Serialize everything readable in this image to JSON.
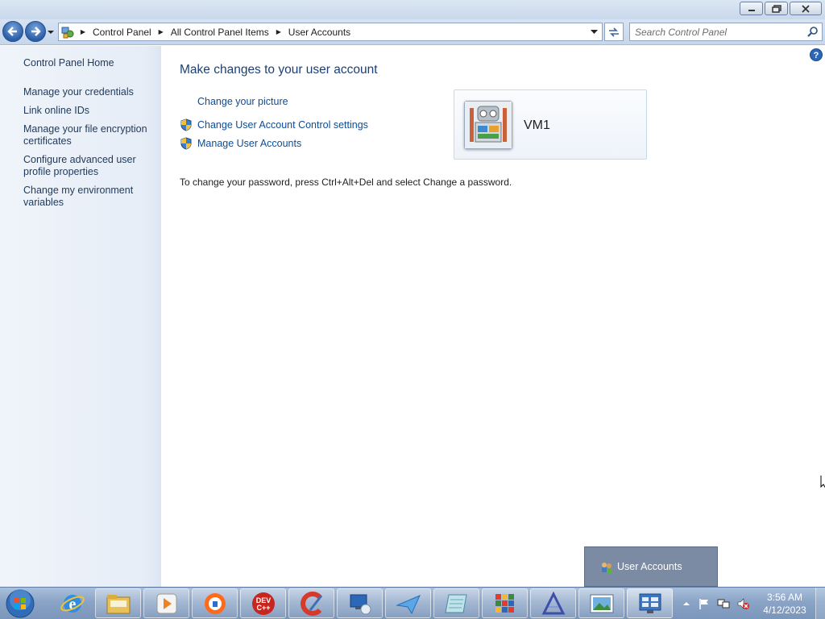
{
  "window": {
    "minimize_label": "Minimize",
    "maximize_label": "Maximize",
    "close_label": "Close"
  },
  "address": {
    "crumbs": [
      "Control Panel",
      "All Control Panel Items",
      "User Accounts"
    ]
  },
  "search": {
    "placeholder": "Search Control Panel"
  },
  "sidebar": {
    "items": [
      "Control Panel Home",
      "Manage your credentials",
      "Link online IDs",
      "Manage your file encryption certificates",
      "Configure advanced user profile properties",
      "Change my environment variables"
    ]
  },
  "main": {
    "heading": "Make changes to your user account",
    "tasks": [
      {
        "label": "Change your picture",
        "shield": false
      },
      {
        "label": "Change User Account Control settings",
        "shield": true
      },
      {
        "label": "Manage User Accounts",
        "shield": true
      }
    ],
    "password_note": "To change your password, press Ctrl+Alt+Del and select Change a password.",
    "user": {
      "name": "VM1"
    }
  },
  "popup": {
    "label": "User Accounts"
  },
  "taskbar": {
    "apps": [
      "start-orb",
      "internet-explorer-icon",
      "file-explorer-icon",
      "media-player-icon",
      "security-app-icon",
      "dev-cpp-icon",
      "ccleaner-icon",
      "remote-desktop-icon",
      "mail-app-icon",
      "notepad-app-icon",
      "avg-icon",
      "vector-app-icon",
      "photo-viewer-icon",
      "control-panel-icon"
    ],
    "dev_label": "DEV C++",
    "clock_time": "3:56 AM",
    "clock_date": "4/12/2023"
  },
  "colors": {
    "link": "#0e4c95",
    "heading": "#1e3f73",
    "sidebar_link": "#1e395b",
    "taskbar": "#8aa4c6"
  }
}
